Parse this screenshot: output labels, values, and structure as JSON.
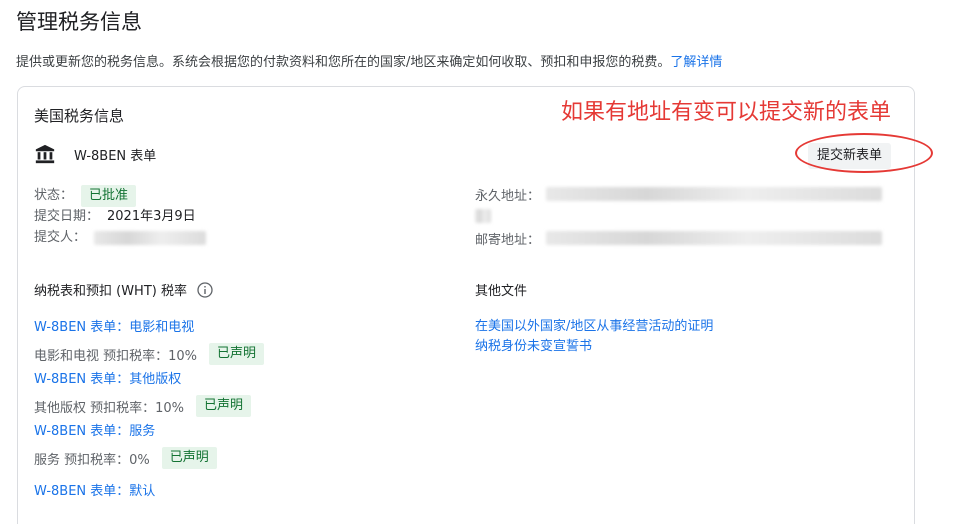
{
  "page": {
    "title": "管理税务信息",
    "description": "提供或更新您的税务信息。系统会根据您的付款资料和您所在的国家/地区来确定如何收取、预扣和申报您的税费。",
    "learn_more": "了解详情"
  },
  "card": {
    "title": "美国税务信息",
    "annotation": "如果有地址有变可以提交新的表单",
    "form_name": "W-8BEN 表单",
    "submit_button": "提交新表单",
    "status_label": "状态：",
    "status_value": "已批准",
    "submit_date_label": "提交日期：",
    "submit_date_value": "2021年3月9日",
    "submitter_label": "提交人：",
    "permanent_address_label": "永久地址：",
    "mailing_address_label": "邮寄地址："
  },
  "wht": {
    "heading": "纳税表和预扣 (WHT) 税率",
    "items": [
      {
        "link": "W-8BEN 表单：电影和电视",
        "rate": "电影和电视 预扣税率：10%",
        "badge": "已声明"
      },
      {
        "link": "W-8BEN 表单：其他版权",
        "rate": "其他版权 预扣税率：10%",
        "badge": "已声明"
      },
      {
        "link": "W-8BEN 表单：服务",
        "rate": "服务 预扣税率：0%",
        "badge": "已声明"
      }
    ],
    "default_link": "W-8BEN 表单：默认"
  },
  "other_docs": {
    "heading": "其他文件",
    "links": [
      "在美国以外国家/地区从事经营活动的证明",
      "纳税身份未变宣誓书"
    ]
  },
  "colors": {
    "link": "#1a73e8",
    "badge_bg": "#e6f4ea",
    "badge_text": "#137333",
    "annotation": "#e53935"
  }
}
